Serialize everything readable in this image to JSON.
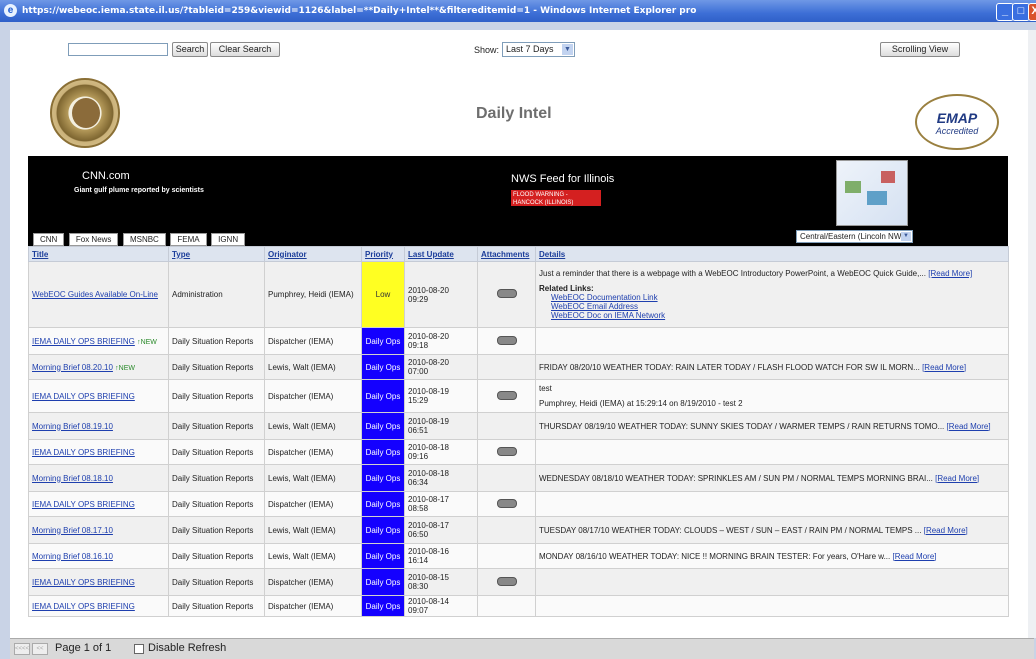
{
  "window": {
    "title": "https://webeoc.iema.state.il.us/?tableid=259&viewid=1126&label=**Daily+Intel**&filtereditemid=1 - Windows Internet Explorer pro",
    "buttons": {
      "minimize": "_",
      "maximize": "□",
      "close": "X"
    }
  },
  "toolbar": {
    "search_value": "",
    "search_label": "Search",
    "clear_label": "Clear Search",
    "show_label": "Show:",
    "show_value": "Last 7 Days",
    "scrolling_label": "Scrolling View"
  },
  "header": {
    "title": "Daily Intel",
    "emap_line1": "EMAP",
    "emap_line2": "Accredited"
  },
  "feeds": {
    "cnn_title": "CNN.com",
    "cnn_headline": "Giant gulf plume reported by scientists",
    "nws_title": "NWS Feed for Illinois",
    "nws_warning": "FLOOD WARNING - HANCOCK (ILLINOIS)",
    "tabs": [
      "CNN",
      "Fox News",
      "MSNBC",
      "FEMA",
      "IGNN"
    ],
    "region_value": "Central/Eastern (Lincoln NWS)"
  },
  "table": {
    "columns": [
      "Title",
      "Type",
      "Originator",
      "Priority",
      "Last Update",
      "Attachments",
      "Details"
    ],
    "rows": [
      {
        "title": "WebEOC Guides Available On-Line",
        "new": "",
        "type": "Administration",
        "originator": "Pumphrey, Heidi (IEMA)",
        "priority": "Low",
        "date": "2010-08-20",
        "time": "09:29",
        "attach": true,
        "details": "Just a reminder that there is a webpage with a WebEOC Introductory PowerPoint, a WebEOC Quick Guide,...",
        "more": "[Read More]",
        "links_label": "Related Links:",
        "links": [
          "WebEOC Documentation Link",
          "WebEOC Email Address",
          "WebEOC Doc on IEMA Network"
        ]
      },
      {
        "title": "IEMA DAILY OPS BRIEFING",
        "new": "NEW",
        "type": "Daily Situation Reports",
        "originator": "Dispatcher (IEMA)",
        "priority": "Daily Ops",
        "date": "2010-08-20",
        "time": "09:18",
        "attach": true,
        "details": "",
        "more": ""
      },
      {
        "title": "Morning Brief 08.20.10",
        "new": "NEW",
        "type": "Daily Situation Reports",
        "originator": "Lewis, Walt (IEMA)",
        "priority": "Daily Ops",
        "date": "2010-08-20",
        "time": "07:00",
        "attach": false,
        "details": "FRIDAY 08/20/10 WEATHER TODAY: RAIN LATER TODAY / FLASH FLOOD WATCH FOR SW IL MORN...",
        "more": "[Read More]"
      },
      {
        "title": "IEMA DAILY OPS BRIEFING",
        "new": "",
        "type": "Daily Situation Reports",
        "originator": "Dispatcher (IEMA)",
        "priority": "Daily Ops",
        "date": "2010-08-19",
        "time": "15:29",
        "attach": true,
        "details": "test",
        "more": "",
        "extra": "Pumphrey, Heidi (IEMA) at 15:29:14 on 8/19/2010 - test 2"
      },
      {
        "title": "Morning Brief 08.19.10",
        "new": "",
        "type": "Daily Situation Reports",
        "originator": "Lewis, Walt (IEMA)",
        "priority": "Daily Ops",
        "date": "2010-08-19",
        "time": "06:51",
        "attach": false,
        "details": "THURSDAY 08/19/10 WEATHER TODAY: SUNNY SKIES TODAY / WARMER TEMPS / RAIN RETURNS TOMO...",
        "more": "[Read More]"
      },
      {
        "title": "IEMA DAILY OPS BRIEFING",
        "new": "",
        "type": "Daily Situation Reports",
        "originator": "Dispatcher (IEMA)",
        "priority": "Daily Ops",
        "date": "2010-08-18",
        "time": "09:16",
        "attach": true,
        "details": "",
        "more": ""
      },
      {
        "title": "Morning Brief 08.18.10",
        "new": "",
        "type": "Daily Situation Reports",
        "originator": "Lewis, Walt (IEMA)",
        "priority": "Daily Ops",
        "date": "2010-08-18",
        "time": "06:34",
        "attach": false,
        "details": "WEDNESDAY 08/18/10 WEATHER TODAY: SPRINKLES AM / SUN PM / NORMAL TEMPS MORNING BRAI...",
        "more": "[Read More]"
      },
      {
        "title": "IEMA DAILY OPS BRIEFING",
        "new": "",
        "type": "Daily Situation Reports",
        "originator": "Dispatcher (IEMA)",
        "priority": "Daily Ops",
        "date": "2010-08-17",
        "time": "08:58",
        "attach": true,
        "details": "",
        "more": ""
      },
      {
        "title": "Morning Brief 08.17.10",
        "new": "",
        "type": "Daily Situation Reports",
        "originator": "Lewis, Walt (IEMA)",
        "priority": "Daily Ops",
        "date": "2010-08-17",
        "time": "06:50",
        "attach": false,
        "details": "TUESDAY 08/17/10 WEATHER TODAY: CLOUDS – WEST / SUN – EAST / RAIN PM / NORMAL TEMPS ...",
        "more": "[Read More]"
      },
      {
        "title": "Morning Brief 08.16.10",
        "new": "",
        "type": "Daily Situation Reports",
        "originator": "Lewis, Walt (IEMA)",
        "priority": "Daily Ops",
        "date": "2010-08-16",
        "time": "16:14",
        "attach": false,
        "details": "MONDAY 08/16/10 WEATHER TODAY: NICE !! MORNING BRAIN TESTER: For years, O'Hare w...",
        "more": "[Read More]"
      },
      {
        "title": "IEMA DAILY OPS BRIEFING",
        "new": "",
        "type": "Daily Situation Reports",
        "originator": "Dispatcher (IEMA)",
        "priority": "Daily Ops",
        "date": "2010-08-15",
        "time": "08:30",
        "attach": true,
        "details": "",
        "more": ""
      },
      {
        "title": "IEMA DAILY OPS BRIEFING",
        "new": "",
        "type": "Daily Situation Reports",
        "originator": "Dispatcher (IEMA)",
        "priority": "Daily Ops",
        "date": "2010-08-14",
        "time": "09:07",
        "attach": false,
        "details": "",
        "more": ""
      }
    ]
  },
  "footer": {
    "first": "<<<<",
    "prev": "<<",
    "page_text": "Page 1 of 1",
    "disable_label": "Disable Refresh"
  }
}
